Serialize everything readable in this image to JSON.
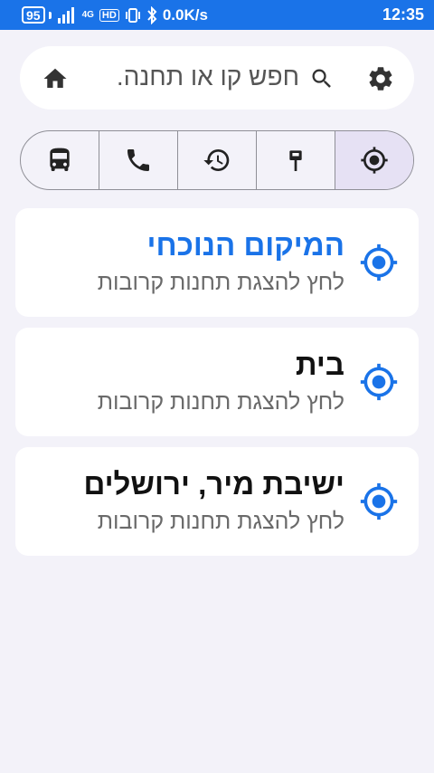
{
  "status_bar": {
    "battery": "95",
    "network_label": "4G",
    "hd_label": "HD",
    "speed": "0.0K/s",
    "time": "12:35"
  },
  "search": {
    "placeholder": "חפש קו או תחנה.",
    "home_icon": "home-icon",
    "search_icon": "search-icon",
    "settings_icon": "gear-icon"
  },
  "tabs": [
    {
      "icon": "bus-icon"
    },
    {
      "icon": "phone-icon"
    },
    {
      "icon": "history-icon"
    },
    {
      "icon": "bus-stop-sign-icon"
    },
    {
      "icon": "my-location-icon",
      "active": true
    }
  ],
  "locations": [
    {
      "title": "המיקום הנוכחי",
      "subtitle": "לחץ להצגת תחנות קרובות",
      "highlight": true
    },
    {
      "title": "בית",
      "subtitle": "לחץ להצגת תחנות קרובות"
    },
    {
      "title": "ישיבת מיר, ירושלים",
      "subtitle": "לחץ להצגת תחנות קרובות"
    }
  ],
  "colors": {
    "primary": "#1a73e8",
    "background": "#f3f2f9",
    "active_tab": "#e6e1f4"
  }
}
